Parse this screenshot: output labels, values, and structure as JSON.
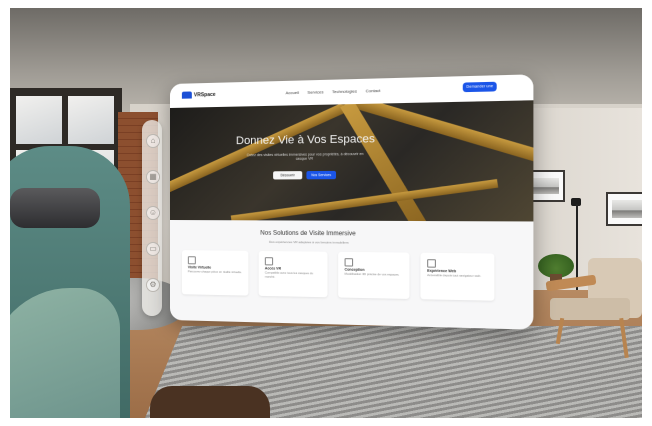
{
  "site": {
    "brand": "VRSpace",
    "nav_items": [
      "Accueil",
      "Services",
      "Technologies",
      "Contact"
    ],
    "cta_label": "Demander une démo"
  },
  "hero": {
    "title": "Donnez Vie à Vos Espaces",
    "subtitle": "Créez des visites virtuelles immersives pour vos propriétés, à découvrir en casque VR",
    "primary_button": "Découvrir",
    "secondary_button": "Nos Services"
  },
  "section": {
    "title": "Nos Solutions de Visite Immersive",
    "subtitle": "Des expériences VR adaptées à vos besoins immobiliers",
    "cards": [
      {
        "title": "Visite Virtuelle",
        "desc": "Parcourez chaque pièce en réalité virtuelle."
      },
      {
        "title": "Accès VR",
        "desc": "Compatible avec tous les casques du marché."
      },
      {
        "title": "Conception",
        "desc": "Modélisation 3D précise de vos espaces."
      },
      {
        "title": "Expérience Web",
        "desc": "Accessible depuis tout navigateur web."
      }
    ]
  },
  "side_nav": {
    "icons": [
      "home-icon",
      "apps-icon",
      "people-icon",
      "window-icon",
      "settings-icon"
    ]
  },
  "colors": {
    "accent": "#1b55e8",
    "beam": "#c79a3f",
    "room_wall": "#e2ddd5"
  }
}
